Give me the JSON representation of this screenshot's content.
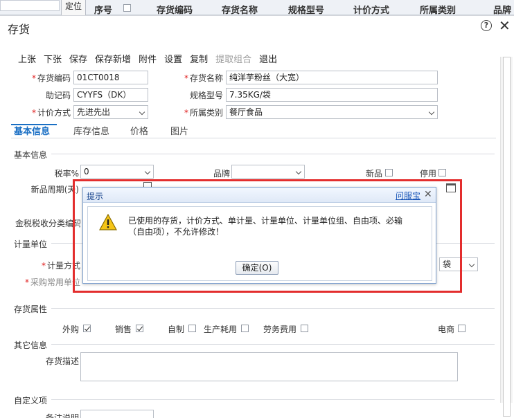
{
  "background_grid": {
    "locate_button": "定位",
    "headers": [
      "序号",
      "存货编码",
      "存货名称",
      "规格型号",
      "计价方式",
      "所属类别",
      "品牌"
    ]
  },
  "window": {
    "title": "存货",
    "help_icon": "question-circle-icon",
    "close_icon": "close-icon"
  },
  "toolbar": {
    "items": [
      {
        "label": "上张",
        "enabled": true
      },
      {
        "label": "下张",
        "enabled": true
      },
      {
        "label": "保存",
        "enabled": true
      },
      {
        "label": "保存新增",
        "enabled": true
      },
      {
        "label": "附件",
        "enabled": true
      },
      {
        "label": "设置",
        "enabled": true
      },
      {
        "label": "复制",
        "enabled": true
      },
      {
        "label": "提取组合",
        "enabled": false
      },
      {
        "label": "退出",
        "enabled": true
      }
    ]
  },
  "header_fields": {
    "inventory_code": {
      "label": "存货编码",
      "value": "01CT0018",
      "required": true
    },
    "inventory_name": {
      "label": "存货名称",
      "value": "纯洋芋粉丝（大宽）",
      "required": true
    },
    "mnemonic": {
      "label": "助记码",
      "value": "CYYFS（DK）"
    },
    "spec_model": {
      "label": "规格型号",
      "value": "7.35KG/袋"
    },
    "pricing_method": {
      "label": "计价方式",
      "value": "先进先出",
      "required": true
    },
    "category": {
      "label": "所属类别",
      "value": "餐厅食品",
      "required": true
    }
  },
  "tabs": [
    {
      "label": "基本信息",
      "active": true
    },
    {
      "label": "库存信息",
      "active": false
    },
    {
      "label": "价格",
      "active": false
    },
    {
      "label": "图片",
      "active": false
    }
  ],
  "basic_info": {
    "section_title": "基本信息",
    "tax_rate_label": "税率%",
    "tax_rate_value": "0",
    "brand_label": "品牌",
    "brand_value": "",
    "new_label": "新品",
    "disabled_label": "停用",
    "new_period_label": "新品周期(天)",
    "tax_class_label": "金税税收分类编码"
  },
  "unit_section": {
    "title": "计量单位",
    "measure_method_label": "计量方式",
    "purchase_unit_label": "采购常用单位",
    "unit_value": "袋"
  },
  "attributes": {
    "title": "存货属性",
    "items": [
      {
        "label": "外购",
        "checked": true
      },
      {
        "label": "销售",
        "checked": true
      },
      {
        "label": "自制",
        "checked": false
      },
      {
        "label": "生产耗用",
        "checked": false
      },
      {
        "label": "劳务费用",
        "checked": false
      },
      {
        "label": "电商",
        "checked": false
      }
    ]
  },
  "other_info": {
    "title": "其它信息",
    "description_label": "存货描述",
    "description_value": ""
  },
  "custom_section": {
    "title": "自定义项",
    "remark_label": "备注说明"
  },
  "dialog": {
    "title": "提示",
    "helper_link": "问服宝",
    "message": "已使用的存货，计价方式、单计量、计量单位、计量单位组、自由项、必输（自由项），不允许修改！",
    "ok_label": "确定(O)",
    "icon": "warning-triangle-icon",
    "highlight_color": "#e32d2d"
  }
}
